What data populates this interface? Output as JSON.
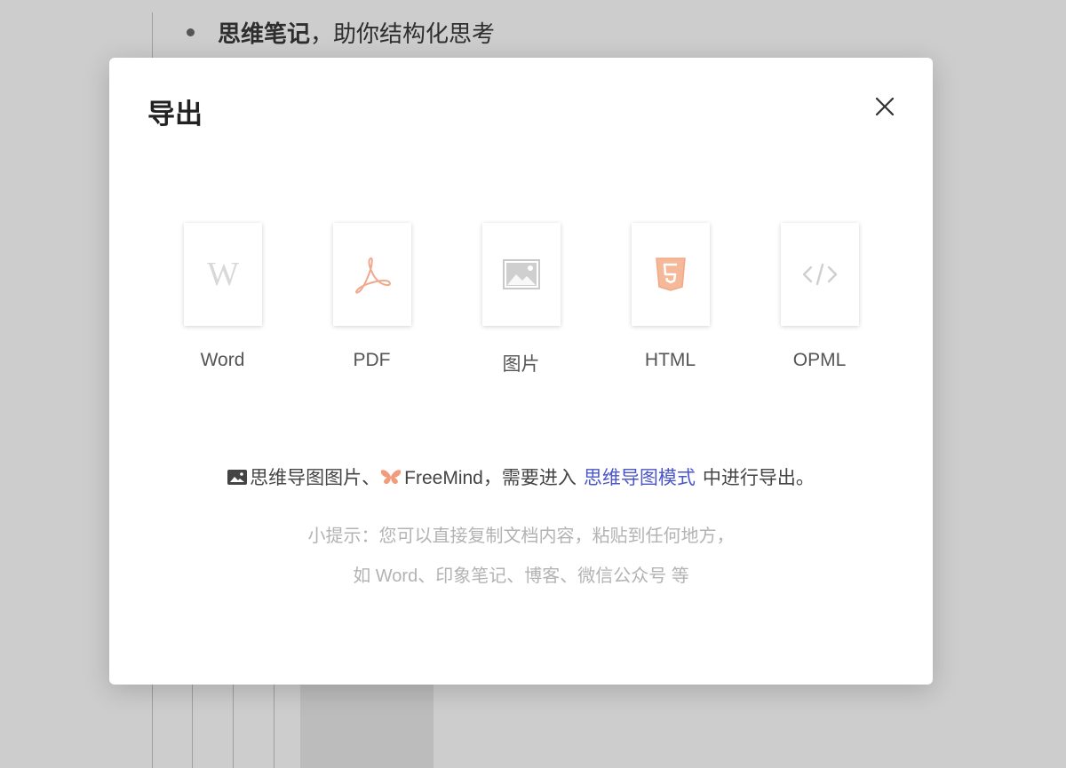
{
  "background": {
    "bullet": {
      "bold": "思维笔记",
      "rest": "，助你结构化思考"
    }
  },
  "modal": {
    "title": "导出",
    "formats": [
      {
        "label": "Word",
        "icon": "word-icon",
        "color": "#d8d8d8"
      },
      {
        "label": "PDF",
        "icon": "pdf-icon",
        "color": "#f0a98c"
      },
      {
        "label": "图片",
        "icon": "image-icon",
        "color": "#c9c9c9"
      },
      {
        "label": "HTML",
        "icon": "html5-icon",
        "color": "#f2a985"
      },
      {
        "label": "OPML",
        "icon": "code-icon",
        "color": "#cfcfcf"
      }
    ],
    "note": {
      "part1": "思维导图图片、",
      "part2": "FreeMind，需要进入",
      "link": "思维导图模式",
      "part3": "中进行导出。"
    },
    "tip_line1": "小提示：您可以直接复制文档内容，粘贴到任何地方，",
    "tip_line2": "如 Word、印象笔记、博客、微信公众号 等"
  },
  "colors": {
    "link": "#4a55c8",
    "overlay": "#cdcdcd",
    "butterfly": "#f29c7c"
  }
}
